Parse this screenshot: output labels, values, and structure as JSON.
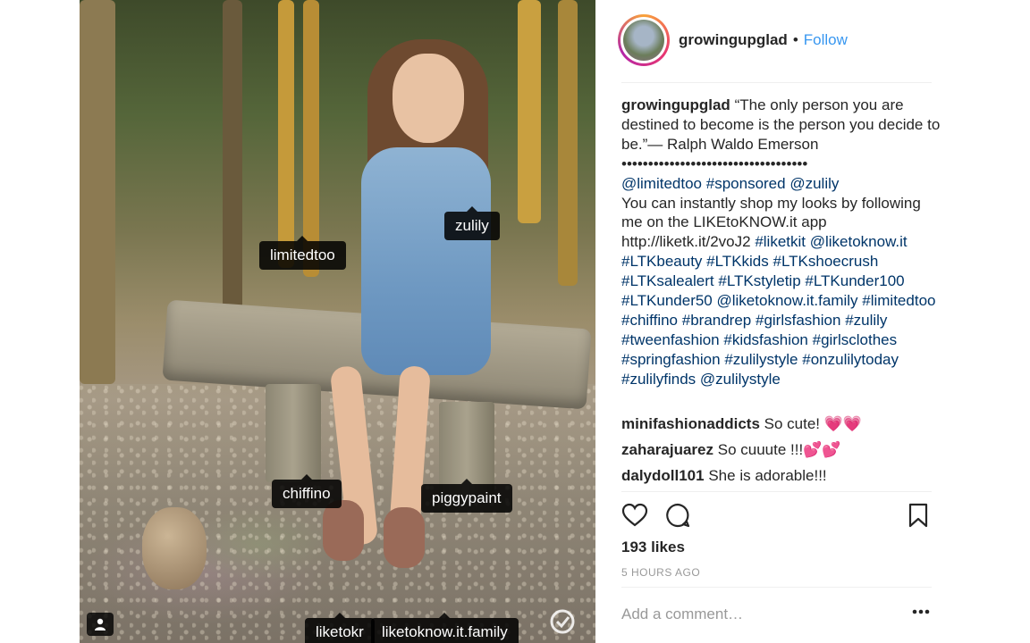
{
  "post": {
    "username": "growingupglad",
    "separator": "•",
    "follow_label": "Follow"
  },
  "photo": {
    "tags": [
      {
        "label": "limitedtoo"
      },
      {
        "label": "zulily"
      },
      {
        "label": "chiffino"
      },
      {
        "label": "piggypaint"
      },
      {
        "label": "liketokr"
      },
      {
        "label": "liketoknow.it.family"
      }
    ]
  },
  "caption": {
    "username": "growingupglad",
    "quote": "“The only person you are destined to become is the person you decide to be.”— Ralph Waldo Emerson",
    "dots": "•••••••••••••••••••••••••••••••••••",
    "mention_limitedtoo": "@limitedtoo",
    "hashtag_sponsored": "#sponsored",
    "mention_zulily": "@zulily",
    "shop_text": "You can instantly shop my looks by following me on the LIKEtoKNOW.it app",
    "url": "http://liketk.it/2voJ2",
    "hashtags_1": [
      "#liketkit",
      "@liketoknow.it",
      "#LTKbeauty",
      "#LTKkids",
      "#LTKshoecrush",
      "#LTKsalealert",
      "#LTKstyletip",
      "#LTKunder100",
      "#LTKunder50",
      "@liketoknow.it.family",
      "#limitedtoo",
      "#chiffino",
      "#brandrep",
      "#girlsfashion",
      "#zulily",
      "#tweenfashion",
      "#kidsfashion",
      "#girlsclothes",
      "#springfashion",
      "#zulilystyle",
      "#onzulilytoday",
      "#zulilyfinds",
      "@zulilystyle"
    ]
  },
  "comments": [
    {
      "user": "minifashionaddicts",
      "text": "So cute! 💗💗"
    },
    {
      "user": "zaharajuarez",
      "text": "So cuuute !!!💕💕"
    },
    {
      "user": "dalydoll101",
      "text": "She is adorable!!!"
    }
  ],
  "actions": {
    "like_icon": "heart-icon",
    "comment_icon": "comment-bubble-icon",
    "save_icon": "bookmark-icon"
  },
  "likes": "193 likes",
  "time": "5 HOURS AGO",
  "add_comment_placeholder": "Add a comment…",
  "more_icon": "more-options-icon"
}
